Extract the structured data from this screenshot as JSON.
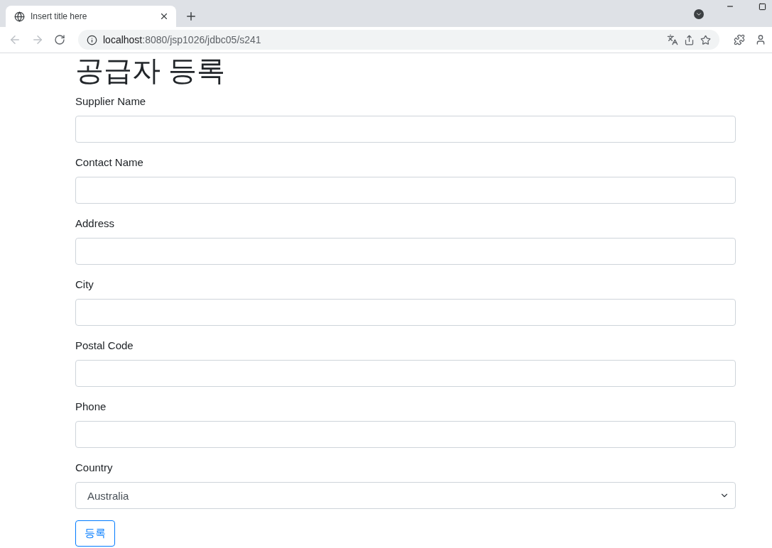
{
  "browser": {
    "tab": {
      "title": "Insert title here"
    },
    "address": {
      "host": "localhost",
      "path": ":8080/jsp1026/jdbc05/s241"
    }
  },
  "page": {
    "heading": "공급자 등록",
    "fields": [
      {
        "kind": "text",
        "label": "Supplier Name"
      },
      {
        "kind": "text",
        "label": "Contact Name"
      },
      {
        "kind": "text",
        "label": "Address"
      },
      {
        "kind": "text",
        "label": "City"
      },
      {
        "kind": "text",
        "label": "Postal Code"
      },
      {
        "kind": "text",
        "label": "Phone"
      },
      {
        "kind": "select",
        "label": "Country",
        "value": "Australia"
      }
    ],
    "submit": "등록"
  }
}
